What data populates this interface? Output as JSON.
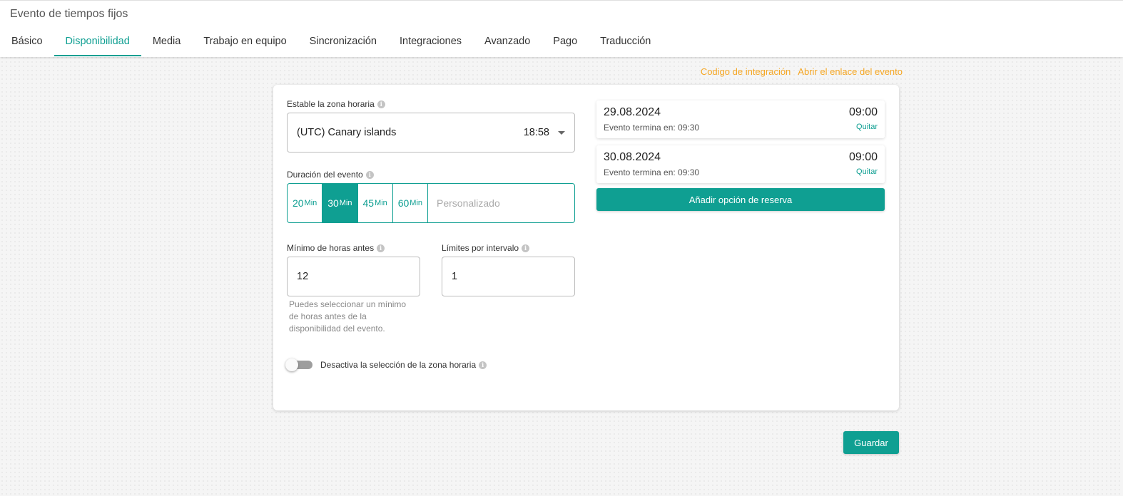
{
  "header": {
    "title": "Evento de tiempos fijos",
    "tabs": [
      {
        "label": "Básico"
      },
      {
        "label": "Disponibilidad",
        "active": true
      },
      {
        "label": "Media"
      },
      {
        "label": "Trabajo en equipo"
      },
      {
        "label": "Sincronización"
      },
      {
        "label": "Integraciones"
      },
      {
        "label": "Avanzado"
      },
      {
        "label": "Pago"
      },
      {
        "label": "Traducción"
      }
    ]
  },
  "links": {
    "integration_code": "Codigo de integración",
    "open_event_link": "Abrir el enlace del evento"
  },
  "timezone": {
    "label": "Estable la zona horaria",
    "selected": "(UTC) Canary islands",
    "current_time": "18:58"
  },
  "duration": {
    "label": "Duración del evento",
    "options": [
      {
        "value": "20",
        "unit": "Min"
      },
      {
        "value": "30",
        "unit": "Min",
        "active": true
      },
      {
        "value": "45",
        "unit": "Min"
      },
      {
        "value": "60",
        "unit": "Min"
      }
    ],
    "custom_placeholder": "Personalizado"
  },
  "min_hours": {
    "label": "Mínimo de horas antes",
    "value": "12",
    "helper": "Puedes seleccionar un mínimo de horas antes de la disponibilidad del evento."
  },
  "interval_limit": {
    "label": "Límites por intervalo",
    "value": "1"
  },
  "timezone_toggle": {
    "label": "Desactiva la selección de la zona horaria",
    "enabled": false
  },
  "slots": [
    {
      "date": "29.08.2024",
      "time": "09:00",
      "ends": "Evento termina en: 09:30",
      "remove": "Quitar"
    },
    {
      "date": "30.08.2024",
      "time": "09:00",
      "ends": "Evento termina en: 09:30",
      "remove": "Quitar"
    }
  ],
  "buttons": {
    "add_slot": "Añadir opción de reserva",
    "save": "Guardar"
  },
  "colors": {
    "accent": "#0f9f92",
    "link": "#f5a623"
  },
  "icons": {
    "info": "info-icon",
    "dropdown": "chevron-down-icon"
  }
}
